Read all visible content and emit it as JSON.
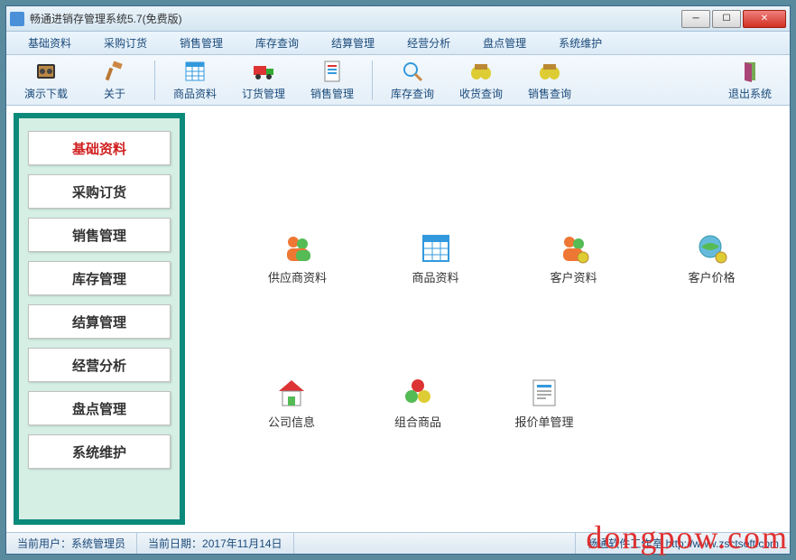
{
  "window": {
    "title": "畅通进销存管理系统5.7(免费版)"
  },
  "menu": {
    "items": [
      {
        "label": "基础资料"
      },
      {
        "label": "采购订货"
      },
      {
        "label": "销售管理"
      },
      {
        "label": "库存查询"
      },
      {
        "label": "结算管理"
      },
      {
        "label": "经营分析"
      },
      {
        "label": "盘点管理"
      },
      {
        "label": "系统维护"
      }
    ]
  },
  "toolbar": {
    "items": [
      {
        "label": "演示下载",
        "icon": "film-icon"
      },
      {
        "label": "关于",
        "icon": "hammer-icon"
      },
      {
        "label": "商品资料",
        "icon": "grid-icon"
      },
      {
        "label": "订货管理",
        "icon": "truck-icon"
      },
      {
        "label": "销售管理",
        "icon": "doc-icon"
      },
      {
        "label": "库存查询",
        "icon": "search-icon"
      },
      {
        "label": "收货查询",
        "icon": "binoc-icon"
      },
      {
        "label": "销售查询",
        "icon": "binoc-icon"
      },
      {
        "label": "退出系统",
        "icon": "door-icon"
      }
    ]
  },
  "sidebar": {
    "items": [
      {
        "label": "基础资料",
        "active": true
      },
      {
        "label": "采购订货"
      },
      {
        "label": "销售管理"
      },
      {
        "label": "库存管理"
      },
      {
        "label": "结算管理"
      },
      {
        "label": "经营分析"
      },
      {
        "label": "盘点管理"
      },
      {
        "label": "系统维护"
      }
    ]
  },
  "main": {
    "row1": [
      {
        "label": "供应商资料",
        "icon": "people-icon"
      },
      {
        "label": "商品资料",
        "icon": "grid-icon"
      },
      {
        "label": "客户资料",
        "icon": "people-gear-icon"
      },
      {
        "label": "客户价格",
        "icon": "globe-gear-icon"
      }
    ],
    "row2": [
      {
        "label": "公司信息",
        "icon": "house-icon"
      },
      {
        "label": "组合商品",
        "icon": "balls-icon"
      },
      {
        "label": "报价单管理",
        "icon": "sheet-icon"
      }
    ]
  },
  "status": {
    "user_label": "当前用户：",
    "user_value": "系统管理员",
    "date_label": "当前日期：",
    "date_value": "2017年11月14日",
    "vendor": "畅通软件工作室  http://www.zsctsoft.com"
  },
  "watermark": "dongpow.com"
}
